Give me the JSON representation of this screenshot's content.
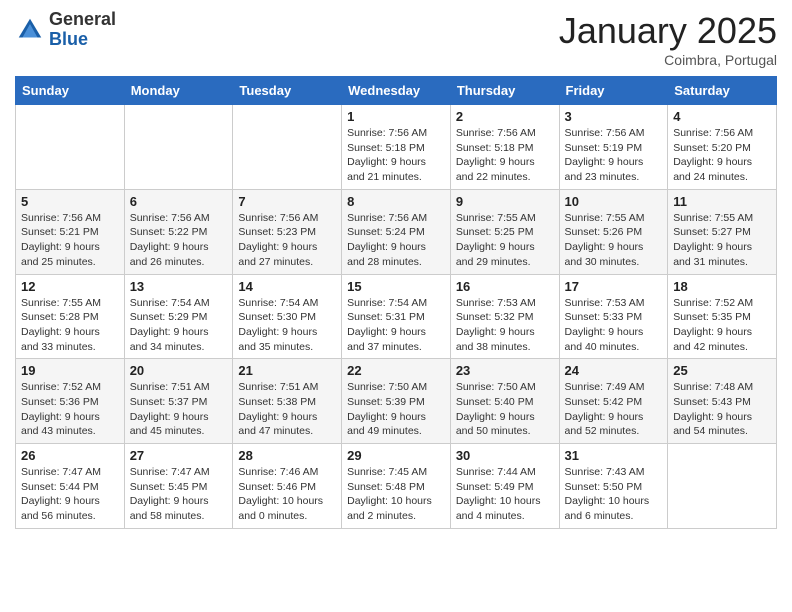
{
  "header": {
    "logo_line1": "General",
    "logo_line2": "Blue",
    "month": "January 2025",
    "location": "Coimbra, Portugal"
  },
  "weekdays": [
    "Sunday",
    "Monday",
    "Tuesday",
    "Wednesday",
    "Thursday",
    "Friday",
    "Saturday"
  ],
  "weeks": [
    [
      {
        "day": "",
        "info": ""
      },
      {
        "day": "",
        "info": ""
      },
      {
        "day": "",
        "info": ""
      },
      {
        "day": "1",
        "info": "Sunrise: 7:56 AM\nSunset: 5:18 PM\nDaylight: 9 hours\nand 21 minutes."
      },
      {
        "day": "2",
        "info": "Sunrise: 7:56 AM\nSunset: 5:18 PM\nDaylight: 9 hours\nand 22 minutes."
      },
      {
        "day": "3",
        "info": "Sunrise: 7:56 AM\nSunset: 5:19 PM\nDaylight: 9 hours\nand 23 minutes."
      },
      {
        "day": "4",
        "info": "Sunrise: 7:56 AM\nSunset: 5:20 PM\nDaylight: 9 hours\nand 24 minutes."
      }
    ],
    [
      {
        "day": "5",
        "info": "Sunrise: 7:56 AM\nSunset: 5:21 PM\nDaylight: 9 hours\nand 25 minutes."
      },
      {
        "day": "6",
        "info": "Sunrise: 7:56 AM\nSunset: 5:22 PM\nDaylight: 9 hours\nand 26 minutes."
      },
      {
        "day": "7",
        "info": "Sunrise: 7:56 AM\nSunset: 5:23 PM\nDaylight: 9 hours\nand 27 minutes."
      },
      {
        "day": "8",
        "info": "Sunrise: 7:56 AM\nSunset: 5:24 PM\nDaylight: 9 hours\nand 28 minutes."
      },
      {
        "day": "9",
        "info": "Sunrise: 7:55 AM\nSunset: 5:25 PM\nDaylight: 9 hours\nand 29 minutes."
      },
      {
        "day": "10",
        "info": "Sunrise: 7:55 AM\nSunset: 5:26 PM\nDaylight: 9 hours\nand 30 minutes."
      },
      {
        "day": "11",
        "info": "Sunrise: 7:55 AM\nSunset: 5:27 PM\nDaylight: 9 hours\nand 31 minutes."
      }
    ],
    [
      {
        "day": "12",
        "info": "Sunrise: 7:55 AM\nSunset: 5:28 PM\nDaylight: 9 hours\nand 33 minutes."
      },
      {
        "day": "13",
        "info": "Sunrise: 7:54 AM\nSunset: 5:29 PM\nDaylight: 9 hours\nand 34 minutes."
      },
      {
        "day": "14",
        "info": "Sunrise: 7:54 AM\nSunset: 5:30 PM\nDaylight: 9 hours\nand 35 minutes."
      },
      {
        "day": "15",
        "info": "Sunrise: 7:54 AM\nSunset: 5:31 PM\nDaylight: 9 hours\nand 37 minutes."
      },
      {
        "day": "16",
        "info": "Sunrise: 7:53 AM\nSunset: 5:32 PM\nDaylight: 9 hours\nand 38 minutes."
      },
      {
        "day": "17",
        "info": "Sunrise: 7:53 AM\nSunset: 5:33 PM\nDaylight: 9 hours\nand 40 minutes."
      },
      {
        "day": "18",
        "info": "Sunrise: 7:52 AM\nSunset: 5:35 PM\nDaylight: 9 hours\nand 42 minutes."
      }
    ],
    [
      {
        "day": "19",
        "info": "Sunrise: 7:52 AM\nSunset: 5:36 PM\nDaylight: 9 hours\nand 43 minutes."
      },
      {
        "day": "20",
        "info": "Sunrise: 7:51 AM\nSunset: 5:37 PM\nDaylight: 9 hours\nand 45 minutes."
      },
      {
        "day": "21",
        "info": "Sunrise: 7:51 AM\nSunset: 5:38 PM\nDaylight: 9 hours\nand 47 minutes."
      },
      {
        "day": "22",
        "info": "Sunrise: 7:50 AM\nSunset: 5:39 PM\nDaylight: 9 hours\nand 49 minutes."
      },
      {
        "day": "23",
        "info": "Sunrise: 7:50 AM\nSunset: 5:40 PM\nDaylight: 9 hours\nand 50 minutes."
      },
      {
        "day": "24",
        "info": "Sunrise: 7:49 AM\nSunset: 5:42 PM\nDaylight: 9 hours\nand 52 minutes."
      },
      {
        "day": "25",
        "info": "Sunrise: 7:48 AM\nSunset: 5:43 PM\nDaylight: 9 hours\nand 54 minutes."
      }
    ],
    [
      {
        "day": "26",
        "info": "Sunrise: 7:47 AM\nSunset: 5:44 PM\nDaylight: 9 hours\nand 56 minutes."
      },
      {
        "day": "27",
        "info": "Sunrise: 7:47 AM\nSunset: 5:45 PM\nDaylight: 9 hours\nand 58 minutes."
      },
      {
        "day": "28",
        "info": "Sunrise: 7:46 AM\nSunset: 5:46 PM\nDaylight: 10 hours\nand 0 minutes."
      },
      {
        "day": "29",
        "info": "Sunrise: 7:45 AM\nSunset: 5:48 PM\nDaylight: 10 hours\nand 2 minutes."
      },
      {
        "day": "30",
        "info": "Sunrise: 7:44 AM\nSunset: 5:49 PM\nDaylight: 10 hours\nand 4 minutes."
      },
      {
        "day": "31",
        "info": "Sunrise: 7:43 AM\nSunset: 5:50 PM\nDaylight: 10 hours\nand 6 minutes."
      },
      {
        "day": "",
        "info": ""
      }
    ]
  ]
}
